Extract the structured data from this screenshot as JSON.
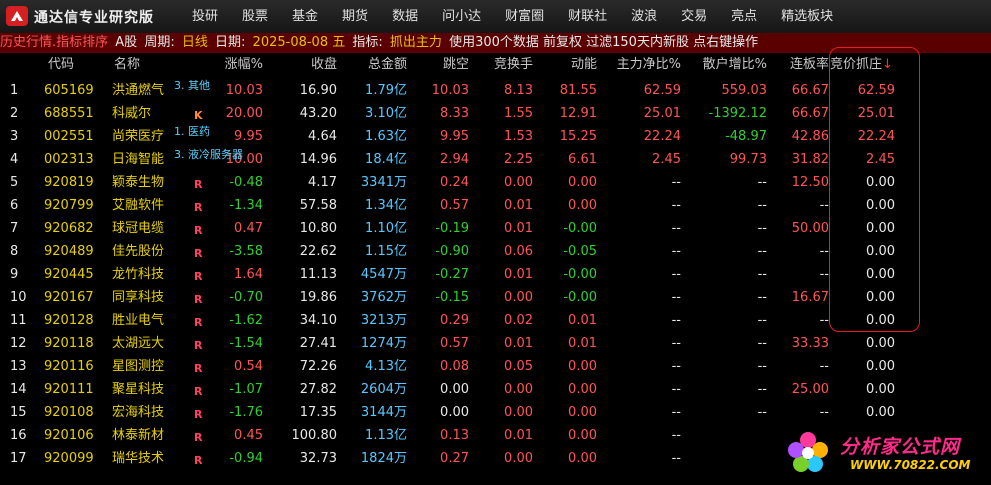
{
  "app": {
    "title": "通达信专业研究版",
    "menu": [
      "投研",
      "股票",
      "基金",
      "期货",
      "数据",
      "问小达",
      "财富圈",
      "财联社",
      "波浪",
      "交易",
      "亮点",
      "精选板块"
    ]
  },
  "infobar": {
    "p1": "历史行情.指标排序",
    "p2": "A股",
    "p3": "周期:",
    "p4": "日线",
    "p5": "日期:",
    "p6": "2025-08-08 五",
    "p7": "指标:",
    "p8": "抓出主力",
    "p9": "使用300个数据 前复权 过滤150天内新股 点右键操作"
  },
  "table": {
    "headers": [
      "代码",
      "名称",
      "涨幅%",
      "收盘",
      "总金额",
      "跳空",
      "竞换手",
      "动能",
      "主力净比%",
      "散户增比%",
      "连板率",
      "竞价抓庄"
    ],
    "sort_arrow": "↓",
    "rows": [
      {
        "idx": "1",
        "code": "605169",
        "name": "洪通燃气",
        "tag": "3. 其他",
        "badge": "",
        "chg": "10.03",
        "close": "16.90",
        "amt": "1.79亿",
        "gap": "10.03",
        "jh": "8.13",
        "dn": "81.55",
        "zl": "62.59",
        "sh": "559.03",
        "lb": "66.67",
        "jj": "62.59",
        "c": {
          "chg": "up",
          "amt": "cyan",
          "gap": "up",
          "jh": "up",
          "dn": "up",
          "zl": "up",
          "sh": "up",
          "lb": "up",
          "jj": "up"
        }
      },
      {
        "idx": "2",
        "code": "688551",
        "name": "科威尔",
        "tag": "",
        "badge": "K",
        "chg": "20.00",
        "close": "43.20",
        "amt": "3.10亿",
        "gap": "8.33",
        "jh": "1.55",
        "dn": "12.91",
        "zl": "25.01",
        "sh": "-1392.12",
        "lb": "66.67",
        "jj": "25.01",
        "c": {
          "chg": "up",
          "amt": "cyan",
          "gap": "up",
          "jh": "up",
          "dn": "up",
          "zl": "up",
          "sh": "down",
          "lb": "up",
          "jj": "up"
        }
      },
      {
        "idx": "3",
        "code": "002551",
        "name": "尚荣医疗",
        "tag": "1. 医药",
        "badge": "",
        "chg": "9.95",
        "close": "4.64",
        "amt": "1.63亿",
        "gap": "9.95",
        "jh": "1.53",
        "dn": "15.25",
        "zl": "22.24",
        "sh": "-48.97",
        "lb": "42.86",
        "jj": "22.24",
        "c": {
          "chg": "up",
          "amt": "cyan",
          "gap": "up",
          "jh": "up",
          "dn": "up",
          "zl": "up",
          "sh": "down",
          "lb": "up",
          "jj": "up"
        }
      },
      {
        "idx": "4",
        "code": "002313",
        "name": "日海智能",
        "tag": "3. 液冷服务器",
        "badge": "",
        "chg": "10.00",
        "close": "14.96",
        "amt": "18.4亿",
        "gap": "2.94",
        "jh": "2.25",
        "dn": "6.61",
        "zl": "2.45",
        "sh": "99.73",
        "lb": "31.82",
        "jj": "2.45",
        "c": {
          "chg": "up",
          "amt": "cyan",
          "gap": "up",
          "jh": "up",
          "dn": "up",
          "zl": "up",
          "sh": "up",
          "lb": "up",
          "jj": "up"
        }
      },
      {
        "idx": "5",
        "code": "920819",
        "name": "颖泰生物",
        "tag": "",
        "badge": "R",
        "chg": "-0.48",
        "close": "4.17",
        "amt": "3341万",
        "gap": "0.24",
        "jh": "0.00",
        "dn": "0.00",
        "zl": "--",
        "sh": "--",
        "lb": "12.50",
        "jj": "0.00",
        "c": {
          "chg": "down",
          "amt": "cyan",
          "gap": "up",
          "jh": "up",
          "dn": "up",
          "zl": "white",
          "sh": "white",
          "lb": "up",
          "jj": "white"
        }
      },
      {
        "idx": "6",
        "code": "920799",
        "name": "艾融软件",
        "tag": "",
        "badge": "R",
        "chg": "-1.34",
        "close": "57.58",
        "amt": "1.34亿",
        "gap": "0.57",
        "jh": "0.01",
        "dn": "0.00",
        "zl": "--",
        "sh": "--",
        "lb": "--",
        "jj": "0.00",
        "c": {
          "chg": "down",
          "amt": "cyan",
          "gap": "up",
          "jh": "up",
          "dn": "up",
          "zl": "white",
          "sh": "white",
          "lb": "white",
          "jj": "white"
        }
      },
      {
        "idx": "7",
        "code": "920682",
        "name": "球冠电缆",
        "tag": "",
        "badge": "R",
        "chg": "0.47",
        "close": "10.80",
        "amt": "1.10亿",
        "gap": "-0.19",
        "jh": "0.01",
        "dn": "-0.00",
        "zl": "--",
        "sh": "--",
        "lb": "50.00",
        "jj": "0.00",
        "c": {
          "chg": "up",
          "amt": "cyan",
          "gap": "down",
          "jh": "up",
          "dn": "down",
          "zl": "white",
          "sh": "white",
          "lb": "up",
          "jj": "white"
        }
      },
      {
        "idx": "8",
        "code": "920489",
        "name": "佳先股份",
        "tag": "",
        "badge": "R",
        "chg": "-3.58",
        "close": "22.62",
        "amt": "1.15亿",
        "gap": "-0.90",
        "jh": "0.06",
        "dn": "-0.05",
        "zl": "--",
        "sh": "--",
        "lb": "--",
        "jj": "0.00",
        "c": {
          "chg": "down",
          "amt": "cyan",
          "gap": "down",
          "jh": "up",
          "dn": "down",
          "zl": "white",
          "sh": "white",
          "lb": "white",
          "jj": "white"
        }
      },
      {
        "idx": "9",
        "code": "920445",
        "name": "龙竹科技",
        "tag": "",
        "badge": "R",
        "chg": "1.64",
        "close": "11.13",
        "amt": "4547万",
        "gap": "-0.27",
        "jh": "0.01",
        "dn": "-0.00",
        "zl": "--",
        "sh": "--",
        "lb": "--",
        "jj": "0.00",
        "c": {
          "chg": "up",
          "amt": "cyan",
          "gap": "down",
          "jh": "up",
          "dn": "down",
          "zl": "white",
          "sh": "white",
          "lb": "white",
          "jj": "white"
        }
      },
      {
        "idx": "10",
        "code": "920167",
        "name": "同享科技",
        "tag": "",
        "badge": "R",
        "chg": "-0.70",
        "close": "19.86",
        "amt": "3762万",
        "gap": "-0.15",
        "jh": "0.00",
        "dn": "-0.00",
        "zl": "--",
        "sh": "--",
        "lb": "16.67",
        "jj": "0.00",
        "c": {
          "chg": "down",
          "amt": "cyan",
          "gap": "down",
          "jh": "up",
          "dn": "down",
          "zl": "white",
          "sh": "white",
          "lb": "up",
          "jj": "white"
        }
      },
      {
        "idx": "11",
        "code": "920128",
        "name": "胜业电气",
        "tag": "",
        "badge": "R",
        "chg": "-1.62",
        "close": "34.10",
        "amt": "3213万",
        "gap": "0.29",
        "jh": "0.02",
        "dn": "0.01",
        "zl": "--",
        "sh": "--",
        "lb": "--",
        "jj": "0.00",
        "c": {
          "chg": "down",
          "amt": "cyan",
          "gap": "up",
          "jh": "up",
          "dn": "up",
          "zl": "white",
          "sh": "white",
          "lb": "white",
          "jj": "white"
        }
      },
      {
        "idx": "12",
        "code": "920118",
        "name": "太湖远大",
        "tag": "",
        "badge": "R",
        "chg": "-1.54",
        "close": "27.41",
        "amt": "1274万",
        "gap": "0.57",
        "jh": "0.01",
        "dn": "0.01",
        "zl": "--",
        "sh": "--",
        "lb": "33.33",
        "jj": "0.00",
        "c": {
          "chg": "down",
          "amt": "cyan",
          "gap": "up",
          "jh": "up",
          "dn": "up",
          "zl": "white",
          "sh": "white",
          "lb": "up",
          "jj": "white"
        }
      },
      {
        "idx": "13",
        "code": "920116",
        "name": "星图测控",
        "tag": "",
        "badge": "R",
        "chg": "0.54",
        "close": "72.26",
        "amt": "4.13亿",
        "gap": "0.08",
        "jh": "0.05",
        "dn": "0.00",
        "zl": "--",
        "sh": "--",
        "lb": "--",
        "jj": "0.00",
        "c": {
          "chg": "up",
          "amt": "cyan",
          "gap": "up",
          "jh": "up",
          "dn": "up",
          "zl": "white",
          "sh": "white",
          "lb": "white",
          "jj": "white"
        }
      },
      {
        "idx": "14",
        "code": "920111",
        "name": "聚星科技",
        "tag": "",
        "badge": "R",
        "chg": "-1.07",
        "close": "27.82",
        "amt": "2604万",
        "gap": "0.00",
        "jh": "0.00",
        "dn": "0.00",
        "zl": "--",
        "sh": "--",
        "lb": "25.00",
        "jj": "0.00",
        "c": {
          "chg": "down",
          "amt": "cyan",
          "gap": "white",
          "jh": "up",
          "dn": "up",
          "zl": "white",
          "sh": "white",
          "lb": "up",
          "jj": "white"
        }
      },
      {
        "idx": "15",
        "code": "920108",
        "name": "宏海科技",
        "tag": "",
        "badge": "R",
        "chg": "-1.76",
        "close": "17.35",
        "amt": "3144万",
        "gap": "0.00",
        "jh": "0.00",
        "dn": "0.00",
        "zl": "--",
        "sh": "--",
        "lb": "--",
        "jj": "0.00",
        "c": {
          "chg": "down",
          "amt": "cyan",
          "gap": "white",
          "jh": "up",
          "dn": "up",
          "zl": "white",
          "sh": "white",
          "lb": "white",
          "jj": "white"
        }
      },
      {
        "idx": "16",
        "code": "920106",
        "name": "林泰新材",
        "tag": "",
        "badge": "R",
        "chg": "0.45",
        "close": "100.80",
        "amt": "1.13亿",
        "gap": "0.13",
        "jh": "0.01",
        "dn": "0.00",
        "zl": "--",
        "sh": "",
        "lb": "",
        "jj": "",
        "c": {
          "chg": "up",
          "amt": "cyan",
          "gap": "up",
          "jh": "up",
          "dn": "up",
          "zl": "white",
          "sh": "white",
          "lb": "white",
          "jj": "white"
        }
      },
      {
        "idx": "17",
        "code": "920099",
        "name": "瑞华技术",
        "tag": "",
        "badge": "R",
        "chg": "-0.94",
        "close": "32.73",
        "amt": "1824万",
        "gap": "0.27",
        "jh": "0.00",
        "dn": "0.00",
        "zl": "--",
        "sh": "",
        "lb": "",
        "jj": "",
        "c": {
          "chg": "down",
          "amt": "cyan",
          "gap": "up",
          "jh": "up",
          "dn": "up",
          "zl": "white",
          "sh": "white",
          "lb": "white",
          "jj": "white"
        }
      }
    ]
  },
  "watermark": {
    "line1": "分析家公式网",
    "line2": "WWW.70822.COM"
  },
  "colors": {
    "up": "#ff5555",
    "down": "#30d030",
    "code": "#e8d000",
    "amount": "#40c8ff",
    "infobar_bg": "#5a0000",
    "highlight": "#e02020"
  }
}
